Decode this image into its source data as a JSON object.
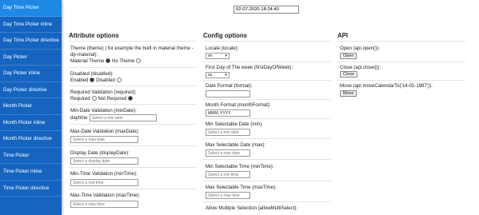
{
  "sidebar": {
    "items": [
      "Day Time Picker",
      "Day Time Picker inline",
      "Day Time Picker directive",
      "Day Picker",
      "Day Picker inline",
      "Day Picker directive",
      "Month Picker",
      "Month Picker inline",
      "Month Picker directive",
      "Time Picker",
      "Time Picker inline",
      "Time Picker directive"
    ]
  },
  "main_input": {
    "value": "02-07-2020 18:24:40"
  },
  "attr": {
    "heading": "Attribute options",
    "theme_label1": "Theme (theme) | for example the built in material theme -",
    "theme_label2": "dp-material):",
    "theme_opt1": "Material Theme",
    "theme_opt2": "No Theme",
    "disabled_label": "Disabled (disabled):",
    "disabled_opt1": "Enabled",
    "disabled_opt2": "Disabled",
    "required_label": "Required Validation (required):",
    "required_opt1": "Required",
    "required_opt2": "Not Required",
    "mindate_label": "Min-Date Validation (minDate):",
    "mindate_prefix": "daytime",
    "mindate_ph": "Select a min date",
    "maxdate_label": "Max-Date Validation (maxDate):",
    "maxdate_ph": "Select a max date",
    "display_label": "Display Date (displayDate):",
    "display_ph": "Select a display date",
    "mintime_label": "Min-Time Validation (minTime):",
    "mintime_ph": "Select a min time",
    "maxtime_label": "Max-Time Validation (maxTime):",
    "maxtime_ph": "Select a max time"
  },
  "config": {
    "heading": "Config options",
    "locale_label": "Locale (locale):",
    "locale_value": "en",
    "fdow_label": "First Day of The week (firstDayOfWeek):",
    "fdow_value": "su",
    "datefmt_label": "Date Format (format):",
    "monthfmt_label": "Month Format (monthFormat):",
    "monthfmt_value": "MMM, YYYY",
    "minsel_label": "Min Selectable Date (min):",
    "minsel_ph": "Select a min date",
    "maxsel_label": "Max Selectable Date (max):",
    "maxsel_ph": "Select a max date",
    "minseltime_label": "Min Selectable Time (minTime):",
    "minseltime_ph": "Select a min time",
    "maxseltime_label": "Max Selectable Time (maxTime):",
    "maxseltime_ph": "Select a max time",
    "multi_label": "Allow Multiple Selection (allowMultiSelect):"
  },
  "api": {
    "heading": "API",
    "open_label": "Open (api.open()):",
    "open_btn": "Open",
    "close_label": "Close (api.close()):",
    "close_btn": "Close",
    "move_label": "Move (api.moveCalendarTo('14-01-1987')):",
    "move_btn": "Move"
  }
}
